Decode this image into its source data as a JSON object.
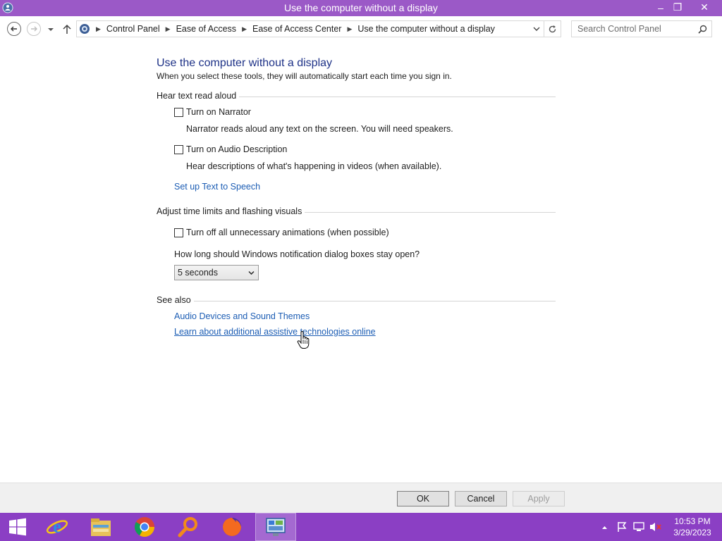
{
  "window": {
    "title": "Use the computer without a display",
    "controls": {
      "minimize": "–",
      "maximize": "❐",
      "close": "✕"
    }
  },
  "address_bar": {
    "breadcrumbs": [
      "Control Panel",
      "Ease of Access",
      "Ease of Access Center",
      "Use the computer without a display"
    ]
  },
  "search": {
    "placeholder": "Search Control Panel"
  },
  "page": {
    "title": "Use the computer without a display",
    "subtitle": "When you select these tools, they will automatically start each time you sign in."
  },
  "sections": {
    "hear_text": {
      "label": "Hear text read aloud",
      "narrator": {
        "label": "Turn on Narrator",
        "checked": false,
        "description": "Narrator reads aloud any text on the screen. You will need speakers."
      },
      "audio_description": {
        "label": "Turn on Audio Description",
        "checked": false,
        "description": "Hear descriptions of what's happening in videos (when available)."
      },
      "tts_link": "Set up Text to Speech"
    },
    "time_limits": {
      "label": "Adjust time limits and flashing visuals",
      "animations": {
        "label": "Turn off all unnecessary animations (when possible)",
        "checked": false
      },
      "question": "How long should Windows notification dialog boxes stay open?",
      "dropdown_value": "5 seconds"
    },
    "see_also": {
      "label": "See also",
      "links": [
        "Audio Devices and Sound Themes",
        "Learn about additional assistive technologies online"
      ]
    }
  },
  "buttons": {
    "ok": "OK",
    "cancel": "Cancel",
    "apply": "Apply"
  },
  "taskbar": {
    "apps": [
      "start-icon",
      "internet-explorer-icon",
      "file-explorer-icon",
      "chrome-icon",
      "search-app-icon",
      "firefox-icon",
      "control-panel-icon"
    ],
    "time": "10:53 PM",
    "date": "3/29/2023"
  },
  "colors": {
    "titlebar": "#9b59c7",
    "taskbar": "#8b3fc4",
    "link": "#1c5db4",
    "title": "#1e3287"
  }
}
